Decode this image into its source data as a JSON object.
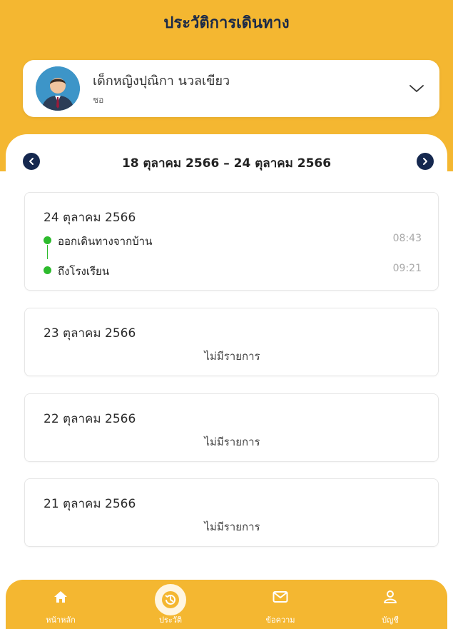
{
  "header": {
    "title": "ประวัติการเดินทาง"
  },
  "profile": {
    "name": "เด็กหญิงปุณิกา นวลเขียว",
    "subtitle": "ชอ"
  },
  "week": {
    "label": "18 ตุลาคม 2566 – 24 ตุลาคม 2566"
  },
  "days": [
    {
      "date": "24 ตุลาคม 2566",
      "events": [
        {
          "label": "ออกเดินทางจากบ้าน",
          "time": "08:43"
        },
        {
          "label": "ถึงโรงเรียน",
          "time": "09:21"
        }
      ]
    },
    {
      "date": "23 ตุลาคม 2566",
      "empty_label": "ไม่มีรายการ"
    },
    {
      "date": "22 ตุลาคม 2566",
      "empty_label": "ไม่มีรายการ"
    },
    {
      "date": "21 ตุลาคม 2566",
      "empty_label": "ไม่มีรายการ"
    }
  ],
  "tabbar": {
    "items": [
      {
        "label": "หน้าหลัก",
        "icon": "home-icon"
      },
      {
        "label": "ประวัติ",
        "icon": "history-icon",
        "active": true
      },
      {
        "label": "ข้อความ",
        "icon": "mail-icon"
      },
      {
        "label": "บัญชี",
        "icon": "account-icon"
      }
    ]
  },
  "colors": {
    "brand": "#F4B731",
    "navy": "#15284f",
    "status_green": "#2dbb2d"
  }
}
